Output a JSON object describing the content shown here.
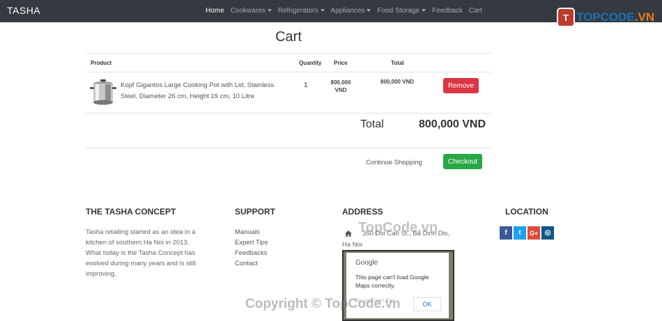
{
  "nav": {
    "brand": "TASHA",
    "items": [
      {
        "label": "Home",
        "dropdown": false,
        "active": true
      },
      {
        "label": "Cookwares",
        "dropdown": true
      },
      {
        "label": "Refrigerators",
        "dropdown": true
      },
      {
        "label": "Appliances",
        "dropdown": true
      },
      {
        "label": "Food Storage",
        "dropdown": true
      },
      {
        "label": "Feedback",
        "dropdown": false
      },
      {
        "label": "Cart",
        "dropdown": false
      }
    ],
    "bg_color": "#343a40"
  },
  "watermark": {
    "logo_letter": "T",
    "logo_text": "TOPCODE",
    "logo_domain": ".VN",
    "mid": "TopCode.vn",
    "bottom": "Copyright © TopCode.vn"
  },
  "cart": {
    "title": "Cart",
    "headers": {
      "product": "Product",
      "quantity": "Quantity",
      "price": "Price",
      "total": "Total"
    },
    "items": [
      {
        "name": "Kopf Gigantos Large Cooking Pot with Lid, Stainless Steel, Diameter 26 cm, Height 19 cm, 10 Litre",
        "quantity": "1",
        "price": "800,000 VND",
        "total": "800,000 VND",
        "remove_label": "Remove",
        "image_icon": "cooking-pot-icon"
      }
    ],
    "total_label": "Total",
    "total_value": "800,000 VND",
    "continue_label": "Continue Shopping",
    "checkout_label": "Checkout",
    "remove_color": "#dc3545",
    "checkout_color": "#28a745"
  },
  "footer": {
    "concept": {
      "title": "THE TASHA CONCEPT",
      "text": "Tasha retailing started as an idea in a kitchen of southern Ha Noi in 2013. What today is the Tasha Concept has evolved during many years and is still improving."
    },
    "support": {
      "title": "SUPPORT",
      "links": [
        "Manuals",
        "Expert Tips",
        "Feedbacks",
        "Contact"
      ]
    },
    "address": {
      "title": "ADDRESS",
      "text": "350 Doi Can St., Ba Dinh Dis, Ha Noi",
      "map": {
        "provider": "Google",
        "message": "This page can't load Google Maps correctly.",
        "sub": "Do you own this",
        "ok_label": "OK"
      }
    },
    "location": {
      "title": "LOCATION",
      "social": [
        {
          "icon": "facebook-icon",
          "glyph": "f",
          "color": "#3b5998"
        },
        {
          "icon": "twitter-icon",
          "glyph": "t",
          "color": "#1da1f2"
        },
        {
          "icon": "google-plus-icon",
          "glyph": "G+",
          "color": "#dd4b39"
        },
        {
          "icon": "instagram-icon",
          "glyph": "◎",
          "color": "#125688"
        }
      ]
    }
  }
}
